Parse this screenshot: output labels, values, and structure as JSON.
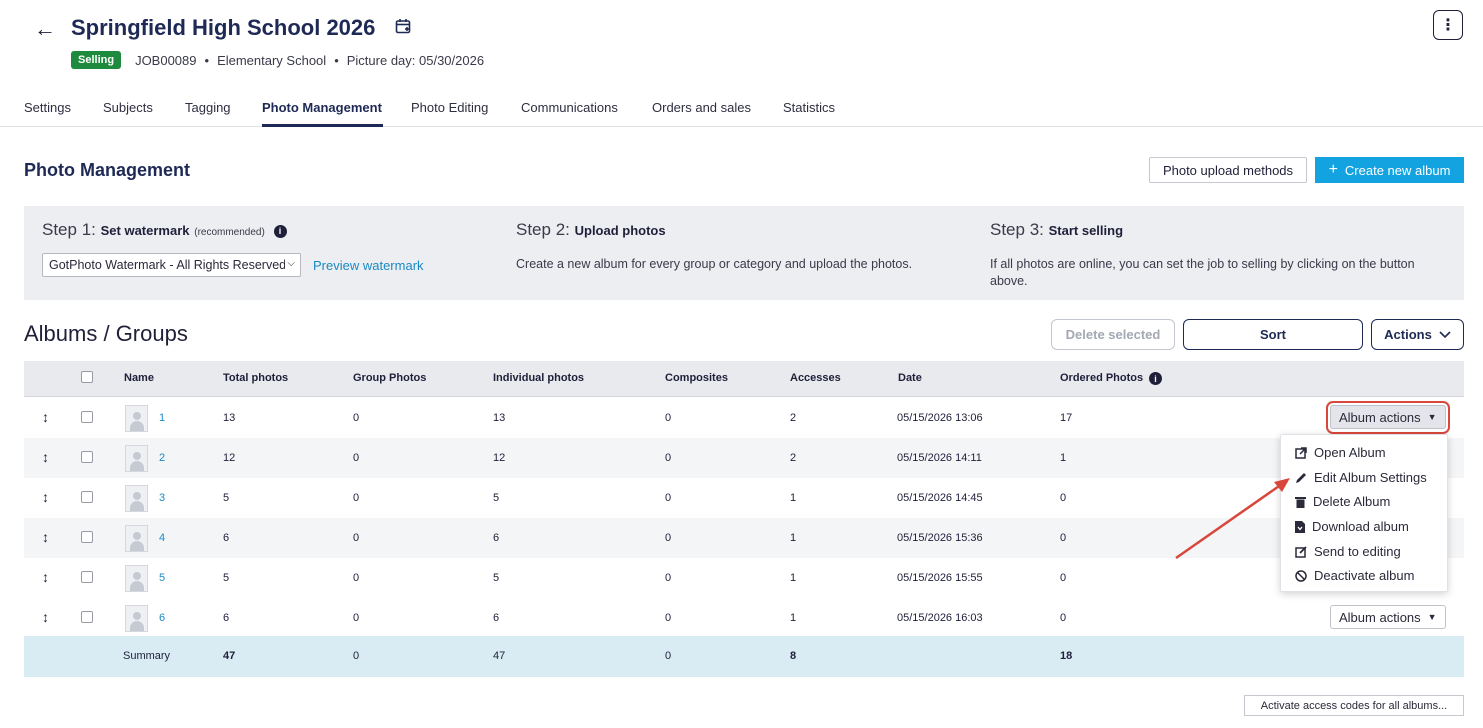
{
  "header": {
    "title": "Springfield High School 2026",
    "badge": "Selling",
    "job_id": "JOB00089",
    "school_type": "Elementary School",
    "picture_day": "Picture day: 05/30/2026",
    "dot": "•"
  },
  "tabs": [
    {
      "label": "Settings"
    },
    {
      "label": "Subjects"
    },
    {
      "label": "Tagging"
    },
    {
      "label": "Photo Management"
    },
    {
      "label": "Photo Editing"
    },
    {
      "label": "Communications"
    },
    {
      "label": "Orders and sales"
    },
    {
      "label": "Statistics"
    }
  ],
  "active_tab": "Photo Management",
  "section": {
    "title": "Photo Management",
    "upload_methods": "Photo upload methods",
    "create_album": "Create new album",
    "create_album_plus": "+"
  },
  "steps": {
    "step1_prefix": "Step 1:",
    "step1_title": "Set watermark",
    "step1_note": "(recommended)",
    "watermark_value": "GotPhoto Watermark - All Rights Reserved",
    "preview": "Preview watermark",
    "step2_prefix": "Step 2:",
    "step2_title": "Upload photos",
    "step2_desc": "Create a new album for every group or category and upload the photos.",
    "step3_prefix": "Step 3:",
    "step3_title": "Start selling",
    "step3_desc": "If all photos are online, you can set the job to selling by clicking on the button above."
  },
  "albums": {
    "title": "Albums / Groups",
    "delete_selected": "Delete selected",
    "sort": "Sort",
    "actions": "Actions"
  },
  "table": {
    "columns": [
      "Name",
      "Total photos",
      "Group Photos",
      "Individual photos",
      "Composites",
      "Accesses",
      "Date",
      "Ordered Photos"
    ],
    "rows": [
      {
        "name": "1",
        "total": "13",
        "group": "0",
        "individual": "13",
        "composites": "0",
        "accesses": "2",
        "date": "05/15/2026 13:06",
        "ordered": "17"
      },
      {
        "name": "2",
        "total": "12",
        "group": "0",
        "individual": "12",
        "composites": "0",
        "accesses": "2",
        "date": "05/15/2026 14:11",
        "ordered": "1"
      },
      {
        "name": "3",
        "total": "5",
        "group": "0",
        "individual": "5",
        "composites": "0",
        "accesses": "1",
        "date": "05/15/2026 14:45",
        "ordered": "0"
      },
      {
        "name": "4",
        "total": "6",
        "group": "0",
        "individual": "6",
        "composites": "0",
        "accesses": "1",
        "date": "05/15/2026 15:36",
        "ordered": "0"
      },
      {
        "name": "5",
        "total": "5",
        "group": "0",
        "individual": "5",
        "composites": "0",
        "accesses": "1",
        "date": "05/15/2026 15:55",
        "ordered": "0"
      },
      {
        "name": "6",
        "total": "6",
        "group": "0",
        "individual": "6",
        "composites": "0",
        "accesses": "1",
        "date": "05/15/2026 16:03",
        "ordered": "0"
      }
    ],
    "summary": {
      "label": "Summary",
      "total": "47",
      "group": "0",
      "individual": "47",
      "composites": "0",
      "accesses": "8",
      "ordered": "18"
    },
    "album_actions": "Album actions"
  },
  "dropdown": {
    "items": [
      {
        "label": "Open Album",
        "icon": "open-external-icon"
      },
      {
        "label": "Edit Album Settings",
        "icon": "pencil-icon"
      },
      {
        "label": "Delete Album",
        "icon": "trash-icon"
      },
      {
        "label": "Download album",
        "icon": "file-download-icon"
      },
      {
        "label": "Send to editing",
        "icon": "edit-box-icon"
      },
      {
        "label": "Deactivate album",
        "icon": "ban-icon"
      }
    ]
  },
  "footer": {
    "activate_codes": "Activate access codes for all albums..."
  },
  "colors": {
    "navy": "#1e2a55",
    "accent_blue": "#12a3e0",
    "selling_green": "#1e8a3e",
    "link_blue": "#1a8ac5",
    "highlight_red": "#d9463b"
  }
}
